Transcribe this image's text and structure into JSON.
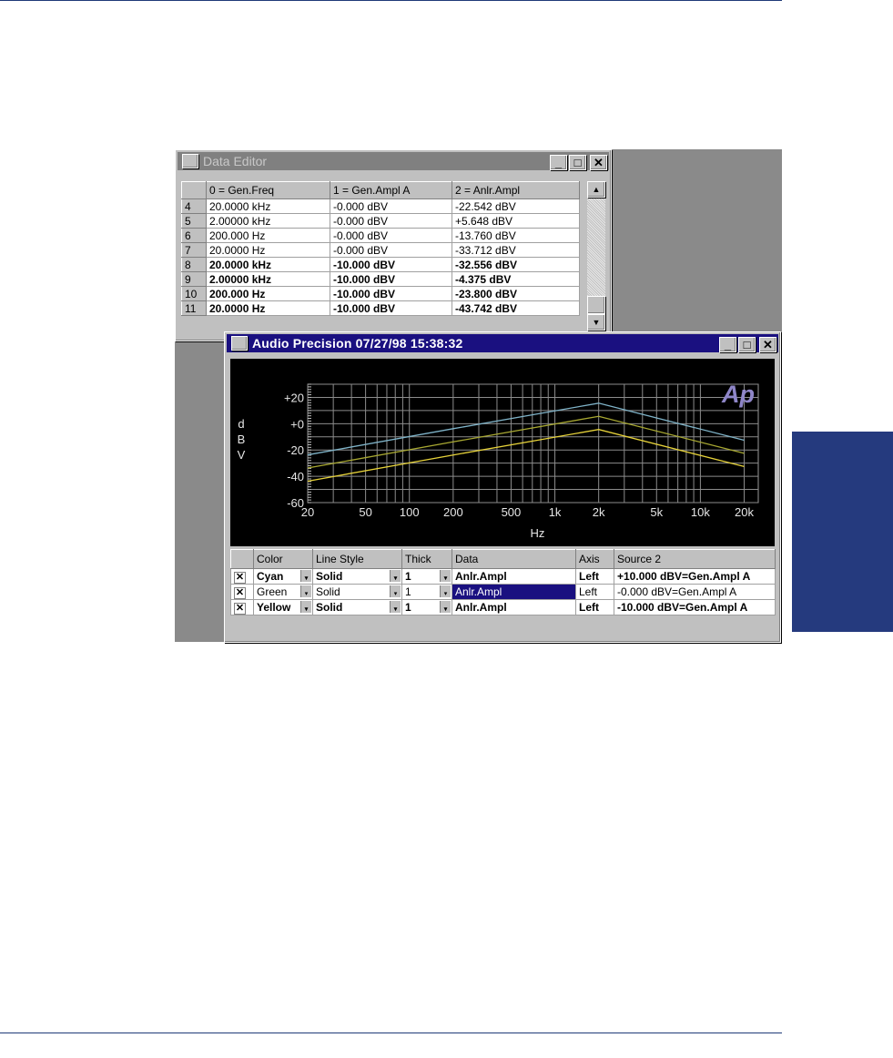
{
  "data_editor": {
    "title": "Data Editor",
    "columns": [
      "0 = Gen.Freq",
      "1 = Gen.Ampl A",
      "2 = Anlr.Ampl"
    ],
    "rows": [
      {
        "n": "4",
        "c0": "20.0000 kHz",
        "c1": "-0.000  dBV",
        "c2": "-22.542  dBV",
        "bold": false
      },
      {
        "n": "5",
        "c0": "2.00000 kHz",
        "c1": "-0.000  dBV",
        "c2": "+5.648  dBV",
        "bold": false
      },
      {
        "n": "6",
        "c0": "200.000  Hz",
        "c1": "-0.000  dBV",
        "c2": "-13.760  dBV",
        "bold": false
      },
      {
        "n": "7",
        "c0": "20.0000  Hz",
        "c1": "-0.000  dBV",
        "c2": "-33.712  dBV",
        "bold": false
      },
      {
        "n": "8",
        "c0": "20.0000 kHz",
        "c1": "-10.000  dBV",
        "c2": "-32.556  dBV",
        "bold": true
      },
      {
        "n": "9",
        "c0": "2.00000 kHz",
        "c1": "-10.000  dBV",
        "c2": "-4.375  dBV",
        "bold": true
      },
      {
        "n": "10",
        "c0": "200.000  Hz",
        "c1": "-10.000  dBV",
        "c2": "-23.800  dBV",
        "bold": true
      },
      {
        "n": "11",
        "c0": "20.0000  Hz",
        "c1": "-10.000  dBV",
        "c2": "-43.742  dBV",
        "bold": true
      }
    ],
    "buttons": {
      "minimize": "_",
      "maximize": "□",
      "close": "✕"
    },
    "scroll_up": "▲",
    "scroll_down": "▼"
  },
  "audio_precision": {
    "title": "Audio Precision    07/27/98 15:38:32",
    "logo": "Ap",
    "buttons": {
      "minimize": "_",
      "maximize": "□",
      "close": "✕"
    },
    "legend_columns": [
      "",
      "Color",
      "Line Style",
      "Thick",
      "Data",
      "Axis",
      "Source 2"
    ],
    "legend_rows": [
      {
        "checked": "✕",
        "color": "Cyan",
        "style": "Solid",
        "thick": "1",
        "data": "Anlr.Ampl",
        "axis": "Left",
        "source": "+10.000  dBV=Gen.Ampl A",
        "bold": true,
        "selected": false
      },
      {
        "checked": "✕",
        "color": "Green",
        "style": "Solid",
        "thick": "1",
        "data": "Anlr.Ampl",
        "axis": "Left",
        "source": "-0.000  dBV=Gen.Ampl A",
        "bold": false,
        "selected": true
      },
      {
        "checked": "✕",
        "color": "Yellow",
        "style": "Solid",
        "thick": "1",
        "data": "Anlr.Ampl",
        "axis": "Left",
        "source": "-10.000  dBV=Gen.Ampl A",
        "bold": true,
        "selected": false
      }
    ]
  },
  "chart_data": {
    "type": "line",
    "xlabel": "Hz",
    "ylabel": "dBV",
    "x_scale": "log",
    "xlim": [
      20,
      25000
    ],
    "ylim": [
      -60,
      30
    ],
    "x_ticks": [
      20,
      50,
      100,
      200,
      500,
      1000,
      2000,
      5000,
      10000,
      20000
    ],
    "x_tick_labels": [
      "20",
      "50",
      "100",
      "200",
      "500",
      "1k",
      "2k",
      "5k",
      "10k",
      "20k"
    ],
    "y_ticks": [
      20,
      0,
      -20,
      -40,
      -60
    ],
    "y_tick_labels": [
      "+20",
      "+0",
      "-20",
      "-40",
      "-60"
    ],
    "grid": true,
    "series": [
      {
        "name": "Cyan",
        "color": "#7fb3c8",
        "x": [
          20,
          200,
          2000,
          20000
        ],
        "y": [
          -23.7,
          -3.8,
          15.6,
          -12.6
        ]
      },
      {
        "name": "Green",
        "color": "#a8a832",
        "x": [
          20,
          200,
          2000,
          20000
        ],
        "y": [
          -33.7,
          -13.8,
          5.6,
          -22.5
        ]
      },
      {
        "name": "Yellow",
        "color": "#e6d23a",
        "x": [
          20,
          200,
          2000,
          20000
        ],
        "y": [
          -43.7,
          -23.8,
          -4.4,
          -32.6
        ]
      }
    ]
  }
}
